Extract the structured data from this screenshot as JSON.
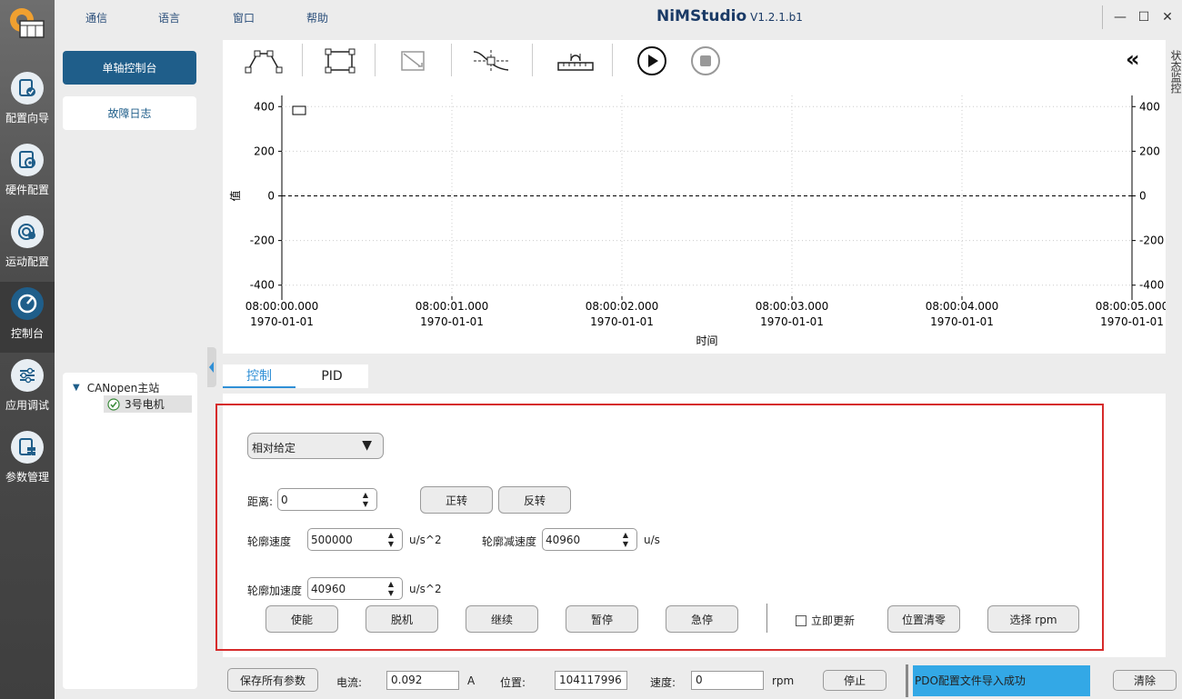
{
  "menu": [
    "通信",
    "语言",
    "窗口",
    "帮助"
  ],
  "app": {
    "name": "NiMStudio",
    "version": "V1.2.1.b1"
  },
  "window_controls": {
    "minimize": "—",
    "maximize": "☐",
    "close": "✕"
  },
  "rail": [
    {
      "label": "配置向导",
      "icon": "config-wizard-icon"
    },
    {
      "label": "硬件配置",
      "icon": "hardware-config-icon"
    },
    {
      "label": "运动配置",
      "icon": "motion-config-icon"
    },
    {
      "label": "控制台",
      "icon": "console-gauge-icon",
      "active": true
    },
    {
      "label": "应用调试",
      "icon": "app-debug-sliders-icon"
    },
    {
      "label": "参数管理",
      "icon": "param-manage-icon"
    }
  ],
  "left_nav": {
    "single_axis": "单轴控制台",
    "fault_log": "故障日志"
  },
  "tree": {
    "root": "CANopen主站",
    "child": "3号电机"
  },
  "right_panel_label": "状态监控",
  "collapse_right": "«",
  "chart_data": {
    "type": "line",
    "xlabel": "时间",
    "ylabel": "值",
    "ylim": [
      -450,
      450
    ],
    "yticks": [
      400,
      200,
      0,
      -200,
      -400
    ],
    "xticks": [
      {
        "time": "08:00:00.000",
        "date": "1970-01-01"
      },
      {
        "time": "08:00:01.000",
        "date": "1970-01-01"
      },
      {
        "time": "08:00:02.000",
        "date": "1970-01-01"
      },
      {
        "time": "08:00:03.000",
        "date": "1970-01-01"
      },
      {
        "time": "08:00:04.000",
        "date": "1970-01-01"
      },
      {
        "time": "08:00:05.000",
        "date": "1970-01-01"
      }
    ],
    "series": [],
    "zero_line": "dashed",
    "grid": true
  },
  "tabs": [
    "控制",
    "PID"
  ],
  "control": {
    "mode_select": "相对给定",
    "distance_label": "距离:",
    "distance_value": "0",
    "forward": "正转",
    "reverse": "反转",
    "profile_speed_label": "轮廓速度",
    "profile_speed_value": "500000",
    "profile_speed_unit": "u/s^2",
    "profile_decel_label": "轮廓减速度",
    "profile_decel_value": "40960",
    "profile_decel_unit": "u/s",
    "profile_accel_label": "轮廓加速度",
    "profile_accel_value": "40960",
    "profile_accel_unit": "u/s^2",
    "enable": "使能",
    "disengage": "脱机",
    "resume": "继续",
    "pause": "暂停",
    "estop": "急停",
    "update_now": "立即更新",
    "clear_position": "位置清零",
    "select_rpm": "选择 rpm"
  },
  "bottom": {
    "save_all": "保存所有参数",
    "current_label": "电流:",
    "current_value": "0.092",
    "current_unit": "A",
    "position_label": "位置:",
    "position_value": "104117996",
    "speed_label": "速度:",
    "speed_value": "0",
    "speed_unit": "rpm",
    "stop": "停止",
    "status_message": "PDO配置文件导入成功",
    "clear": "清除"
  },
  "colors": {
    "accent": "#1f5e8a",
    "highlight": "#2f8fd6",
    "status_bg": "#33a8e6",
    "red_box": "#d62b2b"
  }
}
